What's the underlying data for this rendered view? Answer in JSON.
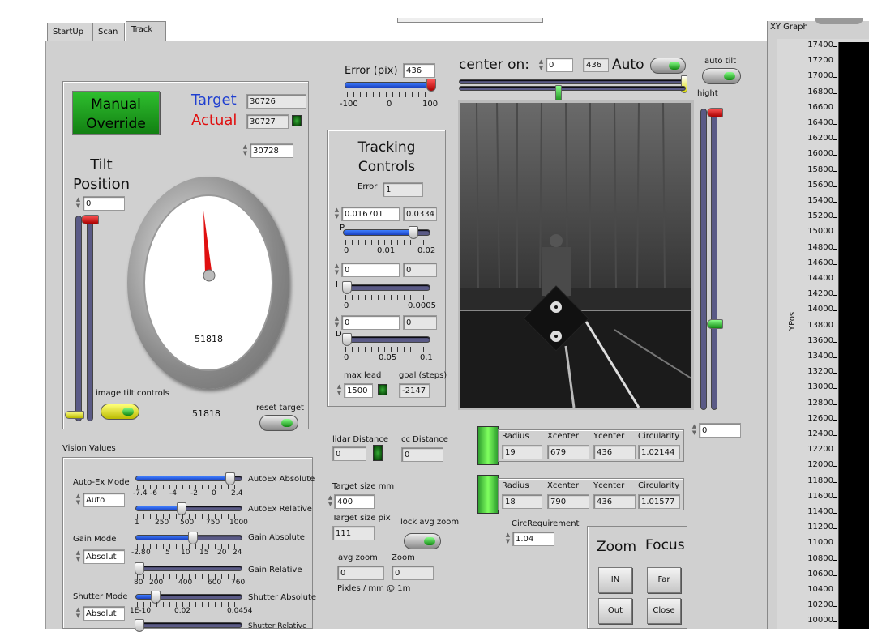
{
  "tabs": [
    "StartUp",
    "Scan",
    "Track"
  ],
  "error_pix": {
    "label": "Error (pix)",
    "value": "436",
    "ticks": [
      "-100",
      "0",
      "100"
    ]
  },
  "center_on": {
    "label": "center on:",
    "value1": "0",
    "value2": "436",
    "auto_label": "Auto"
  },
  "auto_tilt_label": "auto tilt",
  "hight_label": "hight",
  "hight_value": "0",
  "tilt": {
    "manual_override": "Manual Override",
    "target_label": "Target",
    "target_value": "30726",
    "actual_label": "Actual",
    "actual_value": "30727",
    "setpoint_value": "30728",
    "position_label": "Tilt Position",
    "position_value": "0",
    "gauge_value": "51818",
    "bottom_value": "51818",
    "image_tilt_controls": "image tilt controls",
    "reset_target": "reset target"
  },
  "tracking": {
    "title": "Tracking Controls",
    "error_label": "Error",
    "error_value": "1",
    "p_value": "0.016701",
    "p_max": "0.0334",
    "p_label": "P",
    "p_ticks": [
      "0",
      "0.01",
      "0.02"
    ],
    "i_value": "0",
    "i_max": "0",
    "i_label": "I",
    "i_ticks": [
      "0",
      "0.0005"
    ],
    "d_value": "0",
    "d_max": "0",
    "d_label": "D",
    "d_ticks": [
      "0",
      "0.05",
      "0.1"
    ],
    "max_lead_label": "max lead",
    "max_lead_value": "1500",
    "goal_label": "goal (steps)",
    "goal_value": "-2147"
  },
  "vision": {
    "title": "Vision Values",
    "autoex_mode_label": "Auto-Ex Mode",
    "autoex_mode_value": "Auto",
    "autoex_abs_label": "AutoEx Absolute",
    "autoex_abs_ticks": [
      "-7.4",
      "-6",
      "-4",
      "-2",
      "0",
      "2.4"
    ],
    "autoex_rel_label": "AutoEx Relative",
    "autoex_rel_ticks": [
      "1",
      "250",
      "500",
      "750",
      "1000"
    ],
    "gain_mode_label": "Gain Mode",
    "gain_mode_value": "Absolut",
    "gain_abs_label": "Gain Absolute",
    "gain_abs_ticks": [
      "-2.8",
      "0",
      "5",
      "10",
      "15",
      "20",
      "24"
    ],
    "gain_rel_label": "Gain Relative",
    "gain_rel_ticks": [
      "80",
      "200",
      "400",
      "600",
      "760"
    ],
    "shutter_mode_label": "Shutter Mode",
    "shutter_mode_value": "Absolut",
    "shutter_abs_label": "Shutter Absolute",
    "shutter_abs_ticks": [
      "1E-10",
      "0.02",
      "0.0454"
    ],
    "shutter_rel_label": "Shutter Relative"
  },
  "lidar": {
    "label": "lidar Distance",
    "value": "0"
  },
  "cc": {
    "label": "cc Distance",
    "value": "0"
  },
  "target_size_mm": {
    "label": "Target size mm",
    "value": "400"
  },
  "target_size_pix": {
    "label": "Target size pix",
    "value": "111"
  },
  "lock_avg_zoom": "lock avg zoom",
  "avg_zoom": {
    "label": "avg zoom",
    "value": "0"
  },
  "zoom_val": {
    "label": "Zoom",
    "value": "0"
  },
  "pixles_label": "Pixles / mm @ 1m",
  "blobs": [
    {
      "radius": "19",
      "xcenter": "679",
      "ycenter": "436",
      "circularity": "1.02144"
    },
    {
      "radius": "18",
      "xcenter": "790",
      "ycenter": "436",
      "circularity": "1.01577"
    }
  ],
  "blob_headers": [
    "Radius",
    "Xcenter",
    "Ycenter",
    "Circularity"
  ],
  "circ_req": {
    "label": "CircRequirement",
    "value": "1.04"
  },
  "zoom_focus": {
    "zoom": "Zoom",
    "focus": "Focus",
    "in": "IN",
    "out": "Out",
    "far": "Far",
    "close": "Close"
  },
  "xy_graph": {
    "title": "XY Graph",
    "ylabel": "YPos",
    "yticks": [
      "17400",
      "17200",
      "17000",
      "16800",
      "16600",
      "16400",
      "16200",
      "16000",
      "15800",
      "15600",
      "15400",
      "15200",
      "15000",
      "14800",
      "14600",
      "14400",
      "14200",
      "14000",
      "13800",
      "13600",
      "13400",
      "13200",
      "13000",
      "12800",
      "12600",
      "12400",
      "12200",
      "12000",
      "11800",
      "11600",
      "11400",
      "11200",
      "11000",
      "10800",
      "10600",
      "10400",
      "10200",
      "10000"
    ]
  },
  "colors": {
    "target": "#1f3fd0",
    "actual": "#e01010",
    "override_bg": "#1fa31f"
  }
}
